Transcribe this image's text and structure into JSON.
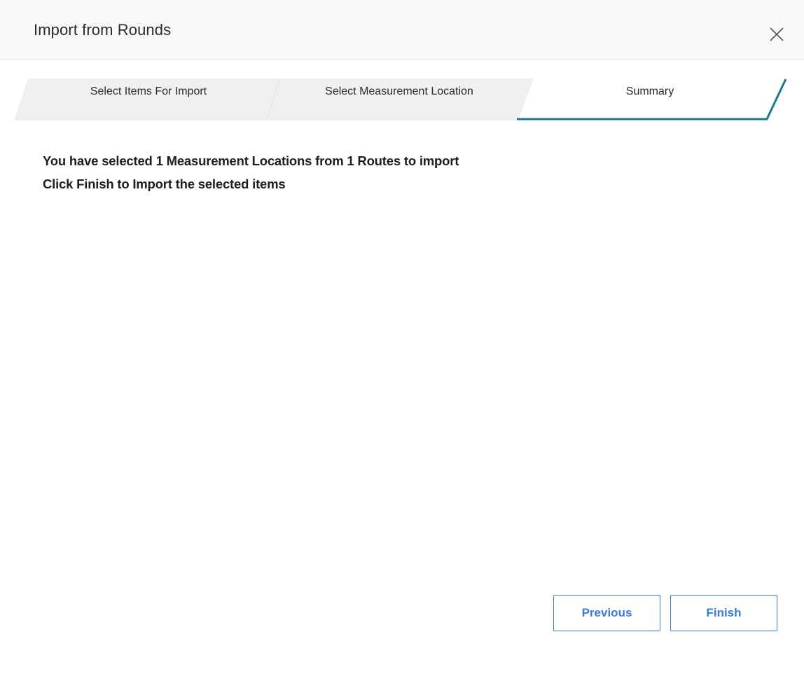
{
  "dialog": {
    "title": "Import from Rounds",
    "close_icon": "close-icon"
  },
  "steps": [
    {
      "label": "Select Items For Import",
      "state": "completed"
    },
    {
      "label": "Select Measurement Location",
      "state": "completed"
    },
    {
      "label": "Summary",
      "state": "active"
    }
  ],
  "summary": {
    "line1": "You have selected 1 Measurement Locations from 1 Routes to import",
    "line2": "Click Finish to Import the selected items"
  },
  "buttons": {
    "previous_label": "Previous",
    "finish_label": "Finish"
  },
  "colors": {
    "accent": "#3a7bd5",
    "active_step_underline": "#1b7a8c",
    "inactive_step_bg": "#f0f0f0"
  }
}
